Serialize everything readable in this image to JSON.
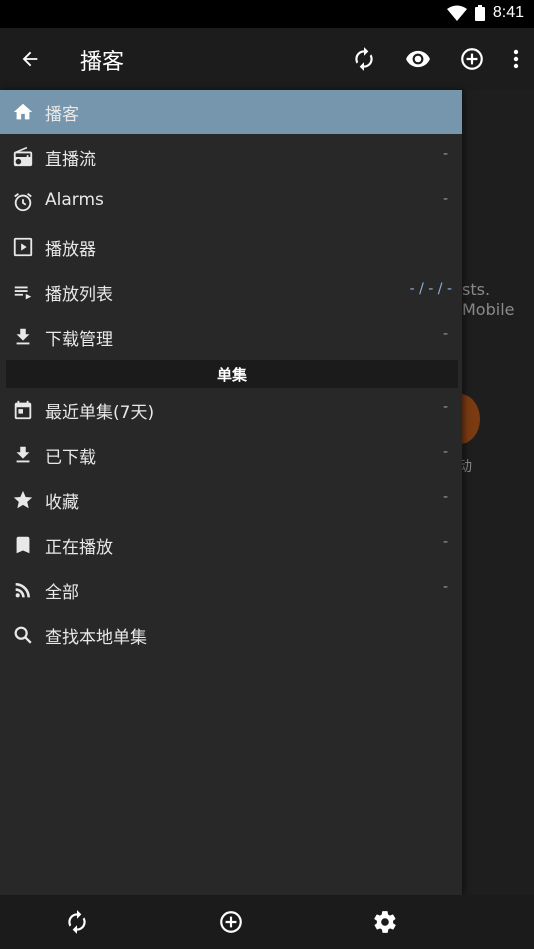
{
  "status_bar": {
    "time": "8:41"
  },
  "app_bar": {
    "title": "播客"
  },
  "background": {
    "fragment_1": "sts.",
    "fragment_2": "Mobile",
    "fragment_3": "动"
  },
  "drawer": {
    "items_top": [
      {
        "label": "播客",
        "count": ""
      },
      {
        "label": "直播流",
        "count": "-"
      },
      {
        "label": "Alarms",
        "count": "-"
      },
      {
        "label": "播放器",
        "count": ""
      },
      {
        "label": "播放列表",
        "count": "- / - / -"
      },
      {
        "label": "下载管理",
        "count": "-"
      }
    ],
    "section_header": "单集",
    "items_episodes": [
      {
        "label": "最近单集(7天)",
        "count": "-"
      },
      {
        "label": "已下载",
        "count": "-"
      },
      {
        "label": "收藏",
        "count": "-"
      },
      {
        "label": "正在播放",
        "count": "-"
      },
      {
        "label": "全部",
        "count": "-"
      },
      {
        "label": "查找本地单集",
        "count": ""
      }
    ]
  },
  "colors": {
    "accent": "#7596ac",
    "drawer_bg": "#282828",
    "icon": "#e8e8e8"
  }
}
